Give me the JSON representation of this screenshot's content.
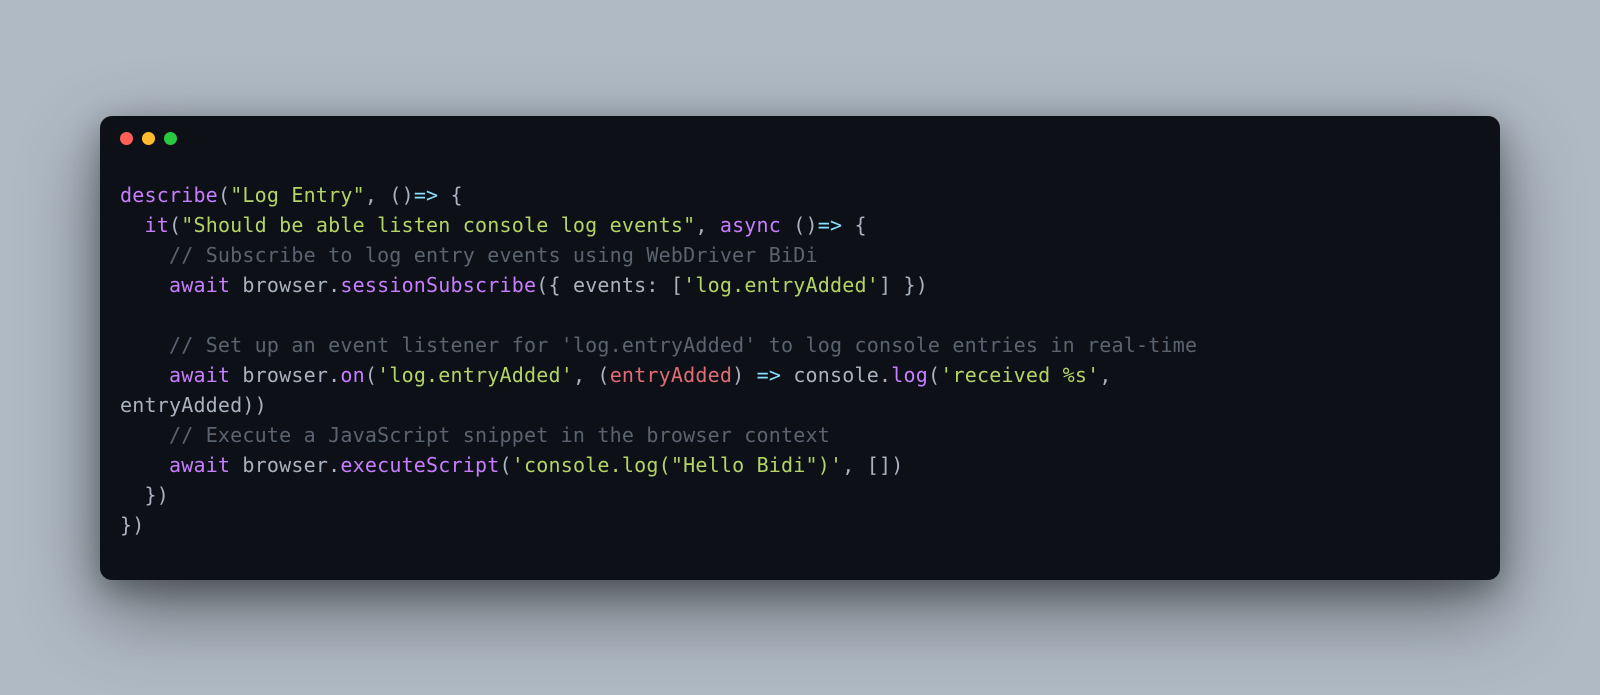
{
  "code": {
    "l1_describe": "describe",
    "l1_str": "\"Log Entry\"",
    "l1_arrow": "()",
    "l1_arrow2": "=>",
    "l1_brace": " {",
    "l2_it": "it",
    "l2_str": "\"Should be able listen console log events\"",
    "l2_async": "async",
    "l2_arrow": "()",
    "l2_arrow2": "=>",
    "l2_brace": " {",
    "l3_comment": "// Subscribe to log entry events using WebDriver BiDi",
    "l4_await": "await",
    "l4_browser": " browser.",
    "l4_method": "sessionSubscribe",
    "l4_open": "({ ",
    "l4_events": "events",
    "l4_colon": ": [",
    "l4_str": "'log.entryAdded'",
    "l4_close": "] })",
    "l5_blank": "",
    "l6_comment": "// Set up an event listener for 'log.entryAdded' to log console entries in real-time",
    "l7_await": "await",
    "l7_browser": " browser.",
    "l7_on": "on",
    "l7_open": "(",
    "l7_str": "'log.entryAdded'",
    "l7_comma": ", (",
    "l7_param": "entryAdded",
    "l7_paren": ") ",
    "l7_arrow": "=>",
    "l7_console": " console.",
    "l7_log": "log",
    "l7_open2": "(",
    "l7_str2": "'received %s'",
    "l7_comma2": ", ",
    "l8_entry": "entryAdded))",
    "l9_comment": "// Execute a JavaScript snippet in the browser context",
    "l10_await": "await",
    "l10_browser": " browser.",
    "l10_method": "executeScript",
    "l10_open": "(",
    "l10_str": "'console.log(\"Hello Bidi\")'",
    "l10_close": ", [])",
    "l11_close": "})",
    "l12_close": "})"
  }
}
